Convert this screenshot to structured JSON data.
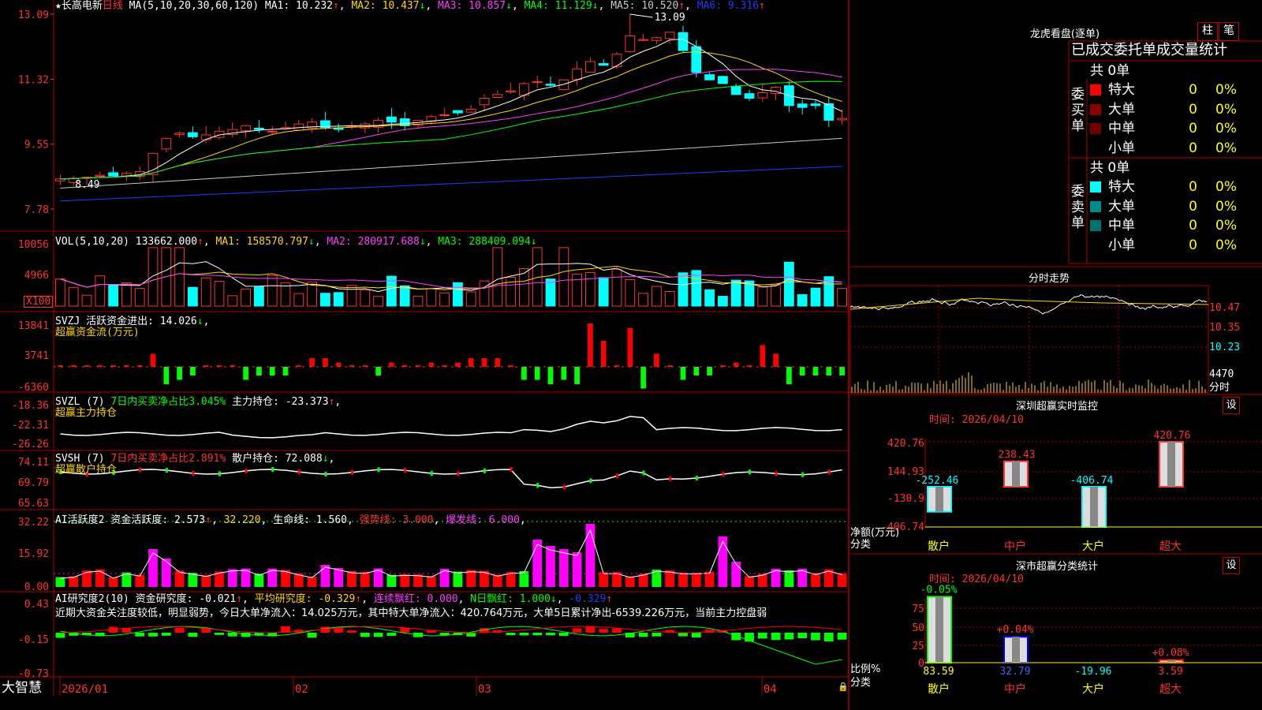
{
  "colors": {
    "up": "#ff3232",
    "down": "#00ffff",
    "grid": "#b00000",
    "axis": "#ff3232",
    "ma1": "#ffffff",
    "ma2": "#ffd700",
    "ma3": "#ff3cff",
    "ma4": "#00ff00",
    "ma5": "#c8c8c8",
    "ma6": "#1e3cff",
    "magenta": "#ff00ff",
    "green": "#00ff00",
    "yellow": "#ffff00",
    "cyan": "#00ffff"
  },
  "window": {
    "app_name": "大智慧",
    "indicator_icon": "lock-icon"
  },
  "price_panel": {
    "stock": "★长高电新",
    "period": "日线",
    "ma_label": "MA(5,10,20,30,60,120)",
    "ma1": "MA1: 10.232",
    "ma2": "MA2: 10.437",
    "ma3": "MA3: 10.857",
    "ma4": "MA4: 11.129",
    "ma5": "MA5: 10.520",
    "ma6": "MA6: 9.316",
    "ticks": [
      "13.09",
      "11.32",
      "9.55",
      "7.78"
    ],
    "high_label": "13.09",
    "low_label": "8.49"
  },
  "vol_panel": {
    "label": "VOL(5,10,20)",
    "v": "133662.000",
    "ma1": "MA1: 158570.797",
    "ma2": "MA2: 280917.688",
    "ma3": "MA3: 288409.094",
    "ticks": [
      "10056",
      "4966"
    ],
    "unit": "X100"
  },
  "svzj_panel": {
    "label": "SVZJ",
    "text1": "活跃资金进出: 14.026",
    "sub": "超赢资金流(万元)",
    "ticks": [
      "13841",
      "3741",
      "-6360"
    ]
  },
  "svzl_panel": {
    "label": "SVZL (7)",
    "text1": "7日内买卖净占比3.045%",
    "text2": "主力持仓: -23.373",
    "sub": "超赢主力持仓",
    "ticks": [
      "-18.36",
      "-22.31",
      "-26.26"
    ]
  },
  "svsh_panel": {
    "label": "SVSH (7)",
    "text1": "7日内买卖净占比2.891%",
    "text2": "散户持仓: 72.088",
    "sub": "超赢散户持仓",
    "ticks": [
      "74.11",
      "69.79",
      "65.63"
    ]
  },
  "ai_panel": {
    "label": "AI活跃度2",
    "text1": "资金活跃度: 2.573",
    "text2": "32.220",
    "text3": "生命线: 1.560",
    "text4": "强势线: 3.000",
    "text5": "爆发线: 6.000",
    "ticks": [
      "32.22",
      "15.92",
      "0.00"
    ]
  },
  "research_panel": {
    "label": "AI研究度2(10)",
    "text1": "资金研究度: -0.021",
    "text2": "平均研究度: -0.329",
    "text3": "连续飘红: 0.000",
    "text4": "N日飘红: 1.000",
    "text5": "-0.329",
    "comment": "近期大资金关注度较低，明显弱势，今日大单净流入：14.025万元，其中特大单净流入：420.764万元，大单5日累计净出-6539.226万元，当前主力控盘弱",
    "ticks": [
      "0.43",
      "-0.15",
      "-0.73"
    ]
  },
  "xaxis": {
    "labels": [
      "2026/01",
      "02",
      "03",
      "04"
    ]
  },
  "right": {
    "dragon": {
      "title": "龙虎看盘(逐单)",
      "btn_bar": "柱",
      "btn_pen": "笔",
      "subtitle": "已成交委托单成交量统计",
      "buy": {
        "side": "委买单",
        "total": "共 0单",
        "rows": [
          {
            "name": "特大",
            "count": "0",
            "pct": "0%",
            "color": "#ff0000"
          },
          {
            "name": "大单",
            "count": "0",
            "pct": "0%",
            "color": "#8b0000"
          },
          {
            "name": "中单",
            "count": "0",
            "pct": "0%",
            "color": "#700000"
          },
          {
            "name": "小单",
            "count": "0",
            "pct": "0%",
            "color": ""
          }
        ]
      },
      "sell": {
        "side": "委卖单",
        "total": "共 0单",
        "rows": [
          {
            "name": "特大",
            "count": "0",
            "pct": "0%",
            "color": "#00ffff"
          },
          {
            "name": "大单",
            "count": "0",
            "pct": "0%",
            "color": "#008b8b"
          },
          {
            "name": "中单",
            "count": "0",
            "pct": "0%",
            "color": "#007070"
          },
          {
            "name": "小单",
            "count": "0",
            "pct": "0%",
            "color": ""
          }
        ]
      }
    },
    "intraday": {
      "title": "分时走势",
      "ticks": [
        "10.47",
        "10.35",
        "10.23"
      ],
      "vol_label": "4470",
      "vol_unit": "分时"
    },
    "sz_monitor": {
      "title": "深圳超赢实时监控",
      "set": "设",
      "time": "时间: 2026/04/10",
      "ylabel": "净额(万元)",
      "xlabel": "分类",
      "ticks": [
        "420.76",
        "144.93",
        "-130.9",
        "-406.74"
      ],
      "chart_data": {
        "type": "bar",
        "categories": [
          "散户",
          "中户",
          "大户",
          "超大"
        ],
        "values": [
          -252.46,
          238.43,
          -406.74,
          420.76
        ],
        "value_labels": [
          "-252.46",
          "238.43",
          "-406.74",
          "420.76"
        ],
        "ylim": [
          -406.74,
          420.76
        ]
      }
    },
    "sz_class": {
      "title": "深市超赢分类统计",
      "set": "设",
      "time": "时间: 2026/04/10",
      "ylabel": "比例%",
      "xlabel": "分类",
      "ticks": [
        "75",
        "50",
        "25",
        "0"
      ],
      "chart_data": {
        "type": "bar",
        "categories": [
          "散户",
          "中户",
          "大户",
          "超大"
        ],
        "values": [
          83.59,
          32.79,
          -19.96,
          3.59
        ],
        "value_labels": [
          "83.59",
          "32.79",
          "-19.96",
          "3.59"
        ],
        "change_labels": [
          "-0.05%",
          "+0.04%",
          "",
          "+0.08%"
        ],
        "ylim": [
          0,
          75
        ]
      }
    }
  }
}
